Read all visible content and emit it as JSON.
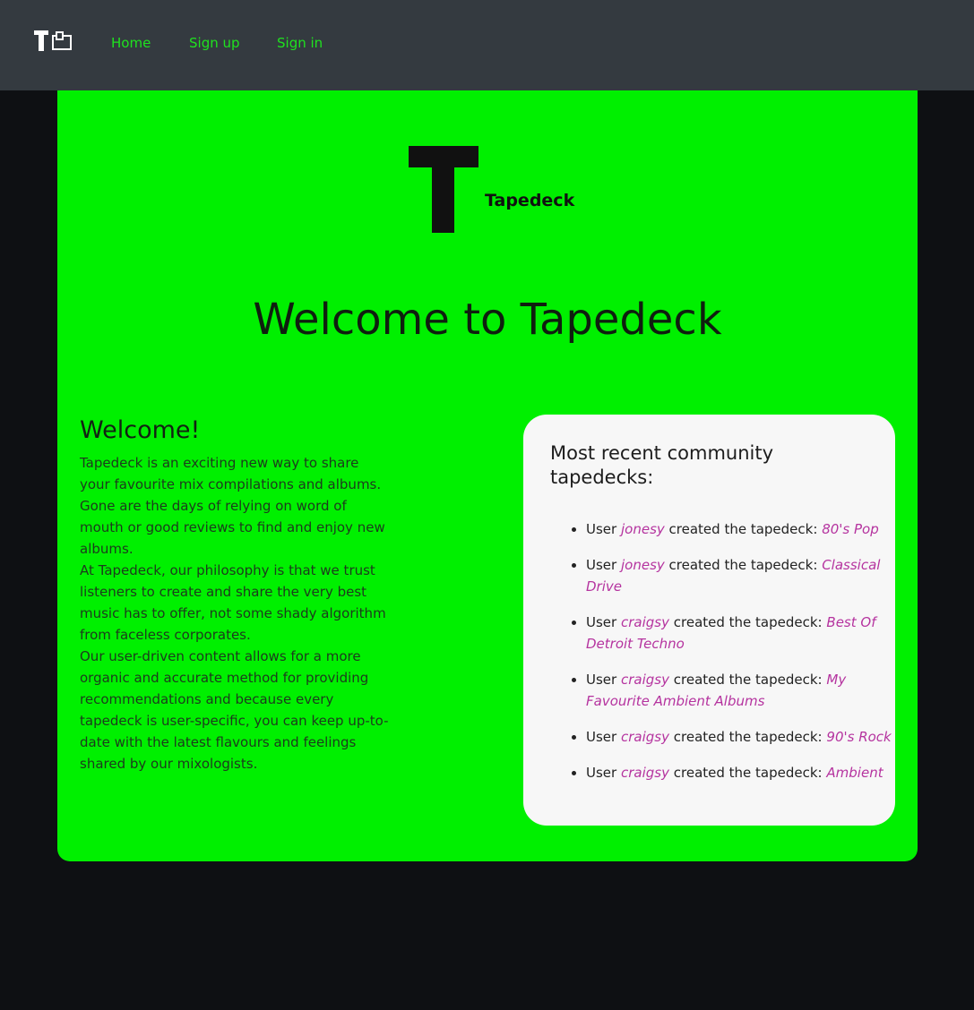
{
  "nav": {
    "logo_icon": "tapedeck-logo-icon",
    "home": "Home",
    "signup": "Sign up",
    "signin": "Sign in",
    "link_color": "#1fe21f",
    "bar_color": "#343a40"
  },
  "hero": {
    "logo_icon": "tapedeck-t-logo-icon",
    "brand": "Tapedeck",
    "title": "Welcome to Tapedeck",
    "card_color": "#00f000"
  },
  "welcome": {
    "heading": "Welcome!",
    "paragraphs": [
      "Tapedeck is an exciting new way to share your favourite mix compilations and albums.",
      "Gone are the days of relying on word of mouth or good reviews to find and enjoy new albums.",
      "At Tapedeck, our philosophy is that we trust listeners to create and share the very best music has to offer, not some shady algorithm from faceless corporates.",
      "Our user-driven content allows for a more organic and accurate method for providing recommendations and because every tapedeck is user-specific, you can keep up-to-date with the latest flavours and feelings shared by our mixologists."
    ]
  },
  "recent": {
    "heading": "Most recent community tapedecks:",
    "prefix": "User",
    "middle": "created the tapedeck:",
    "link_color": "#b5339f",
    "items": [
      {
        "user": "jonesy",
        "tapedeck": "80's Pop"
      },
      {
        "user": "jonesy",
        "tapedeck": "Classical Drive"
      },
      {
        "user": "craigsy",
        "tapedeck": "Best Of Detroit Techno"
      },
      {
        "user": "craigsy",
        "tapedeck": "My Favourite Ambient Albums"
      },
      {
        "user": "craigsy",
        "tapedeck": "90's Rock"
      },
      {
        "user": "craigsy",
        "tapedeck": "Ambient"
      }
    ]
  }
}
